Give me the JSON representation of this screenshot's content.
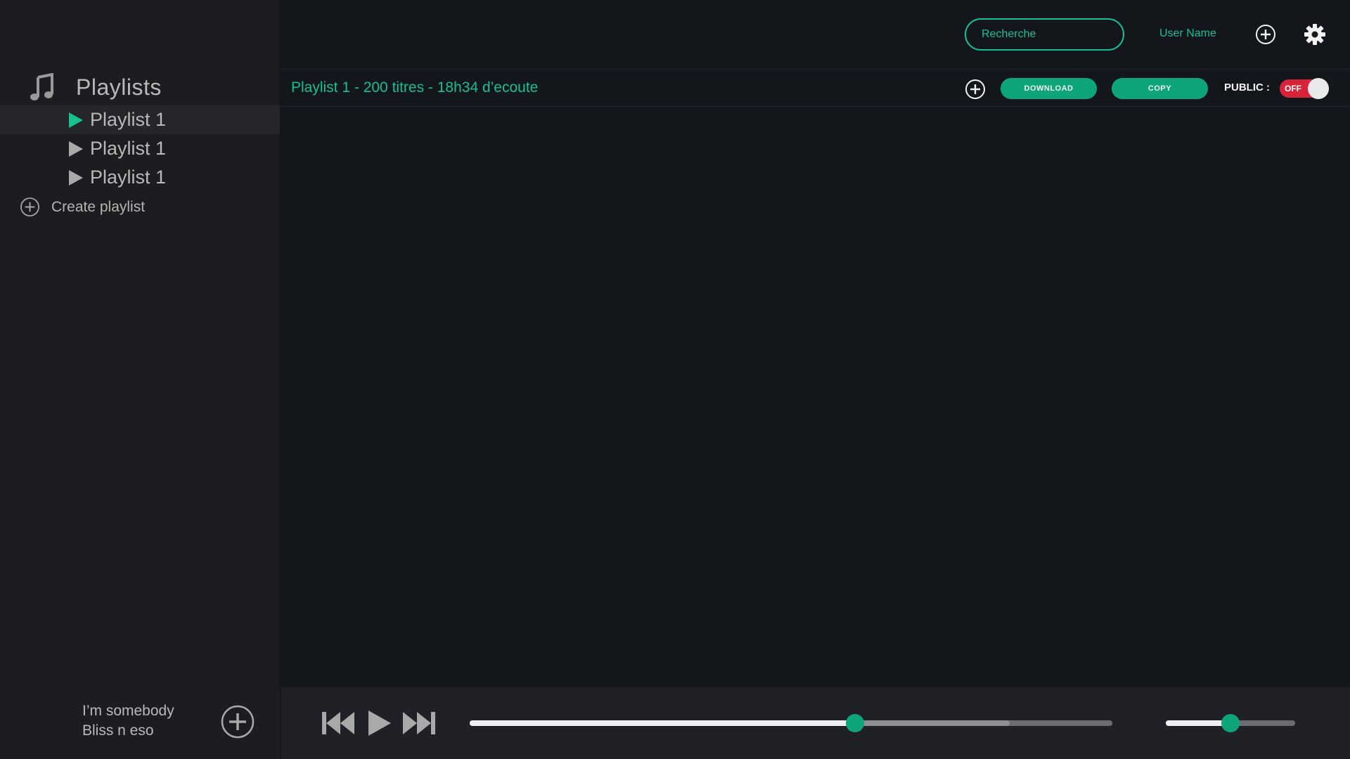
{
  "sidebar": {
    "title": "Playlists",
    "items": [
      {
        "label": "Playlist 1",
        "active": true
      },
      {
        "label": "Playlist 1",
        "active": false
      },
      {
        "label": "Playlist 1",
        "active": false
      }
    ],
    "create_label": "Create playlist"
  },
  "topbar": {
    "search_placeholder": "Recherche",
    "username": "User Name"
  },
  "playlist_bar": {
    "title": "Playlist 1 - 200 titres - 18h34 d’ecoute",
    "download_label": "DOWNLOAD",
    "copy_label": "COPY",
    "public_label": "PUBLIC :",
    "public_toggle_text": "OFF",
    "public_enabled": false
  },
  "now_playing": {
    "title": "I’m somebody",
    "artist": "Bliss n eso"
  },
  "player": {
    "progress": 0.6,
    "buffered": 0.84,
    "volume": 0.5
  },
  "colors": {
    "accent": "#16c08f",
    "button": "#0fa57b",
    "toggle_off": "#d8243a",
    "background": "#13161b",
    "sidebar": "#1c1d20",
    "active_play_icon": "#16c08f",
    "inactive_play_icon": "#a9a9a9"
  },
  "icons": {
    "music_note": "music-note-icon",
    "play": "play-icon",
    "add": "plus-circle-icon",
    "settings": "gear-icon",
    "previous": "skip-previous-icon",
    "next": "skip-next-icon"
  }
}
